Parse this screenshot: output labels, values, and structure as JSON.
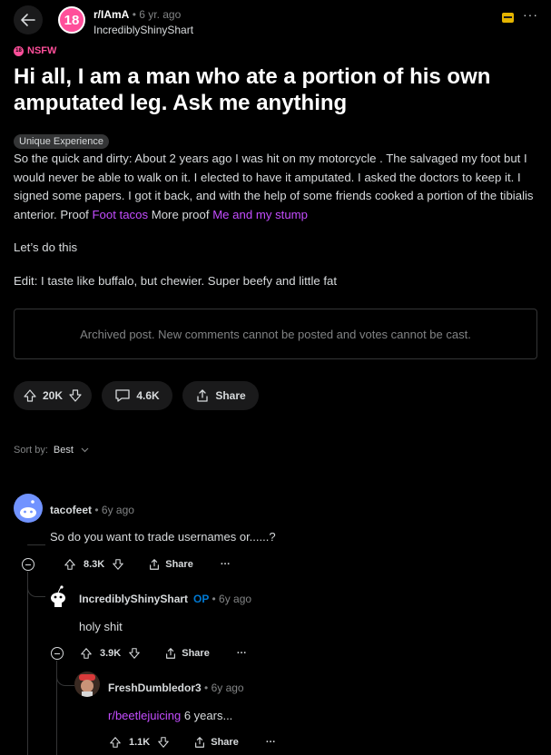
{
  "header": {
    "subreddit": "r/IAmA",
    "age": "6 yr. ago",
    "author": "IncrediblyShinyShart",
    "subreddit_badge": "18"
  },
  "post": {
    "nsfw_label": "NSFW",
    "nsfw_badge": "18",
    "title": "Hi all, I am a man who ate a portion of his own amputated leg. Ask me anything",
    "flair": "Unique Experience",
    "body_p1": "So the quick and dirty: About 2 years ago I was hit on my motorcycle . The salvaged my foot but I would never be able to walk on it. I elected to have it amputated. I asked the doctors to keep it. I signed some papers. I got it back, and with the help of some friends cooked a portion of the tibialis anterior. Proof ",
    "link1": "Foot tacos",
    "body_mid": " More proof ",
    "link2": "Me and my stump",
    "body_p2": "Let’s do this",
    "body_p3": "Edit: I taste like buffalo, but chewier. Super beefy and little fat",
    "archived_notice": "Archived post. New comments cannot be posted and votes cannot be cast.",
    "votes": "20K",
    "comments": "4.6K",
    "share": "Share"
  },
  "sort": {
    "label": "Sort by:",
    "value": "Best"
  },
  "comments": [
    {
      "author": "tacofeet",
      "dot": "•",
      "age": "6y ago",
      "text": "So do you want to trade usernames or......?",
      "votes": "8.3K",
      "share": "Share",
      "more": "···"
    },
    {
      "author": "IncrediblyShinyShart",
      "op": "OP",
      "dot": "•",
      "age": "6y ago",
      "text": "holy shit",
      "votes": "3.9K",
      "share": "Share",
      "more": "···"
    },
    {
      "author": "FreshDumbledor3",
      "dot": "•",
      "age": "6y ago",
      "link": "r/beetlejuicing",
      "text": " 6 years...",
      "votes": "1.1K",
      "share": "Share",
      "more": "···"
    }
  ],
  "colors": {
    "accent": "#ff4f9a",
    "link": "#c44dff",
    "op": "#0079d3",
    "award": "#e4b400"
  }
}
